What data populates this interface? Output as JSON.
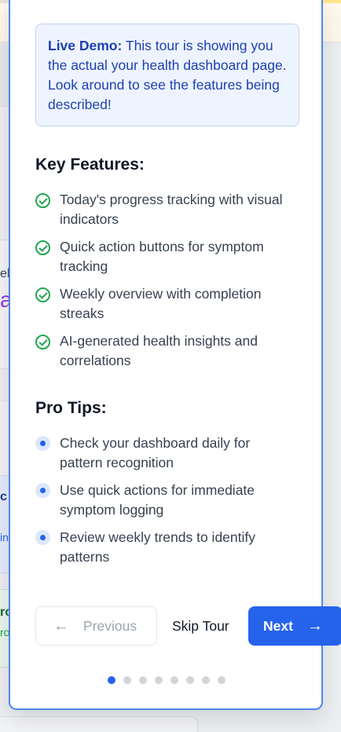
{
  "demo": {
    "bold": "Live Demo:",
    "text": "This tour is showing you the actual your health dashboard page. Look around to see the features being described!"
  },
  "features": {
    "title": "Key Features:",
    "items": [
      "Today's progress tracking with visual indicators",
      "Quick action buttons for symptom tracking",
      "Weekly overview with completion streaks",
      "AI-generated health insights and correlations"
    ]
  },
  "tips": {
    "title": "Pro Tips:",
    "items": [
      "Check your dashboard daily for pattern recognition",
      "Use quick actions for immediate symptom logging",
      "Review weekly trends to identify patterns"
    ]
  },
  "nav": {
    "previous": "Previous",
    "skip": "Skip Tour",
    "next": "Next",
    "prev_icon": "arrow-left-icon",
    "next_icon": "arrow-right-icon"
  },
  "progress": {
    "total_steps": 8,
    "current_step": 1
  },
  "background_fragments": [
    "ek",
    "a",
    "c",
    "in",
    "ro",
    "ro"
  ],
  "colors": {
    "accent": "#2563eb",
    "success": "#22a551",
    "demo_bg": "#eef4ff",
    "demo_text": "#1e40af"
  }
}
